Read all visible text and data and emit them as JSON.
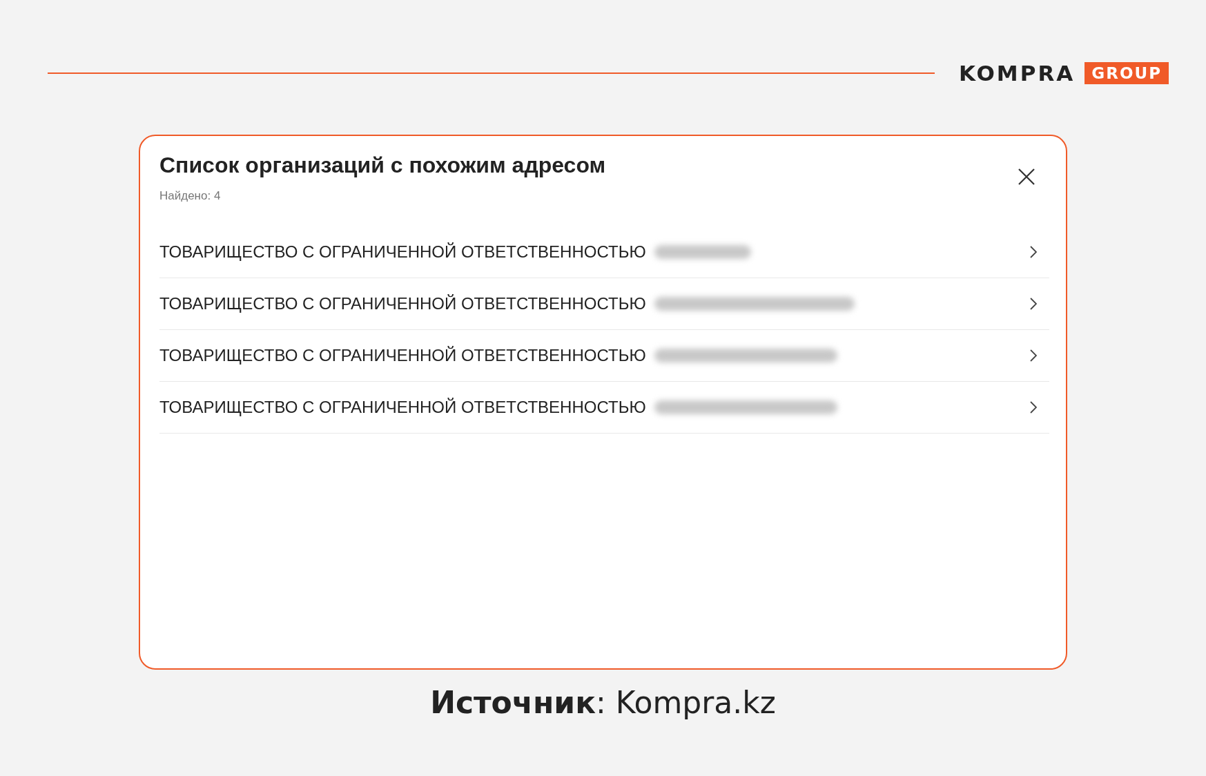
{
  "brand": {
    "name": "KOMPRA",
    "badge": "GROUP"
  },
  "dialog": {
    "title": "Список организаций с похожим адресом",
    "subtitle": "Найдено: 4",
    "items": [
      {
        "label": "ТОВАРИЩЕСТВО С ОГРАНИЧЕННОЙ ОТВЕТСТВЕННОСТЬЮ",
        "redacted": true
      },
      {
        "label": "ТОВАРИЩЕСТВО С ОГРАНИЧЕННОЙ ОТВЕТСТВЕННОСТЬЮ",
        "redacted": true
      },
      {
        "label": "ТОВАРИЩЕСТВО С ОГРАНИЧЕННОЙ ОТВЕТСТВЕННОСТЬЮ",
        "redacted": true
      },
      {
        "label": "ТОВАРИЩЕСТВО С ОГРАНИЧЕННОЙ ОТВЕТСТВЕННОСТЬЮ",
        "redacted": true
      }
    ]
  },
  "caption": "**Источник**: Kompra.kz"
}
